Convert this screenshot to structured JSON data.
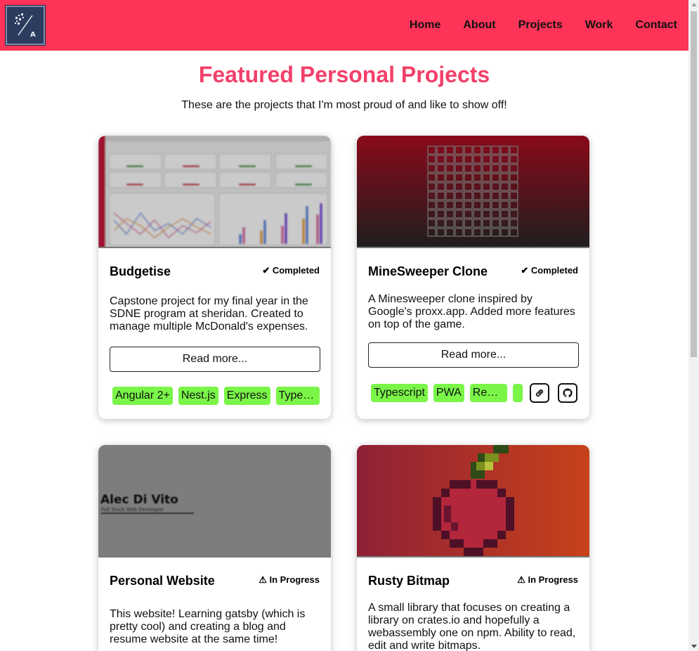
{
  "nav": {
    "items": [
      {
        "label": "Home"
      },
      {
        "label": "About"
      },
      {
        "label": "Projects"
      },
      {
        "label": "Work"
      },
      {
        "label": "Contact"
      }
    ],
    "active": "Projects"
  },
  "page": {
    "title": "Featured Personal Projects",
    "subtitle": "These are the projects that I'm most proud of and like to show off!"
  },
  "projects": [
    {
      "title": "Budgetise",
      "status": "✔ Completed",
      "description": "Capstone project for my final year in the SDNE program at sheridan. Created to manage multiple McDonald's expenses.",
      "read_more": "Read more...",
      "tags": [
        "Angular 2+",
        "Nest.js",
        "Express",
        "Type…"
      ]
    },
    {
      "title": "MineSweeper Clone",
      "status": "✔ Completed",
      "description": "A Minesweeper clone inspired by Google's proxx.app. Added more features on top of the game.",
      "read_more": "Read more...",
      "tags": [
        "Typescript",
        "PWA",
        "React…"
      ]
    },
    {
      "title": "Personal Website",
      "status": "⚠ In Progress",
      "description": "This website! Learning gatsby (which is pretty cool) and creating a blog and resume website at the same time!",
      "image_text": {
        "name": "Alec Di Vito",
        "role": "Full Stack Web Developer"
      }
    },
    {
      "title": "Rusty Bitmap",
      "status": "⚠ In Progress",
      "description": "A small library that focuses on creating a library on crates.io and hopefully a webassembly one on npm. Ability to read, edit and write bitmaps."
    }
  ],
  "colors": {
    "brand": "#fe3358",
    "title": "#f2406a",
    "tag": "#7af548"
  },
  "icons": {
    "logo": "alec-logo-icon",
    "link": "link-icon",
    "github": "github-icon"
  }
}
